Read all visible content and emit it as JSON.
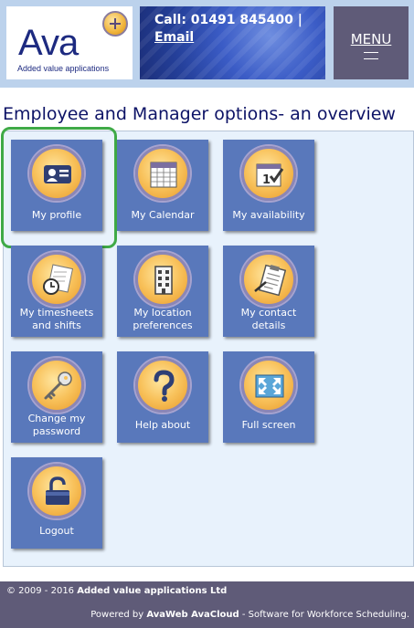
{
  "header": {
    "logo_word": "Ava",
    "logo_tagline": "Added value applications",
    "call_text": "Call: 01491 845400 |",
    "email_label": "Email",
    "menu_label": "MENU"
  },
  "page_title": "Employee and Manager options- an overview",
  "tiles": [
    {
      "label": "My profile",
      "icon": "id-card-icon",
      "highlighted": true
    },
    {
      "label": "My Calendar",
      "icon": "calendar-icon"
    },
    {
      "label": "My availability",
      "icon": "availability-calendar-icon"
    },
    {
      "label": "My timesheets and shifts",
      "icon": "timesheet-clock-icon"
    },
    {
      "label": "My location preferences",
      "icon": "building-icon"
    },
    {
      "label": "My contact details",
      "icon": "clipboard-icon"
    },
    {
      "label": "Change my password",
      "icon": "key-icon"
    },
    {
      "label": "Help about",
      "icon": "question-mark-icon"
    },
    {
      "label": "Full screen",
      "icon": "fullscreen-arrows-icon"
    },
    {
      "label": "Logout",
      "icon": "padlock-icon"
    }
  ],
  "colors": {
    "tile": "#5978bb",
    "highlight": "#3faa47",
    "title": "#0d1366",
    "footer": "#5f5b78"
  },
  "footer": {
    "copyright": "© 2009 - 2016",
    "company": "Added value applications Ltd",
    "powered_by": "Powered by",
    "product": "AvaWeb AvaCloud",
    "tagline": "- Software for Workforce Scheduling."
  }
}
